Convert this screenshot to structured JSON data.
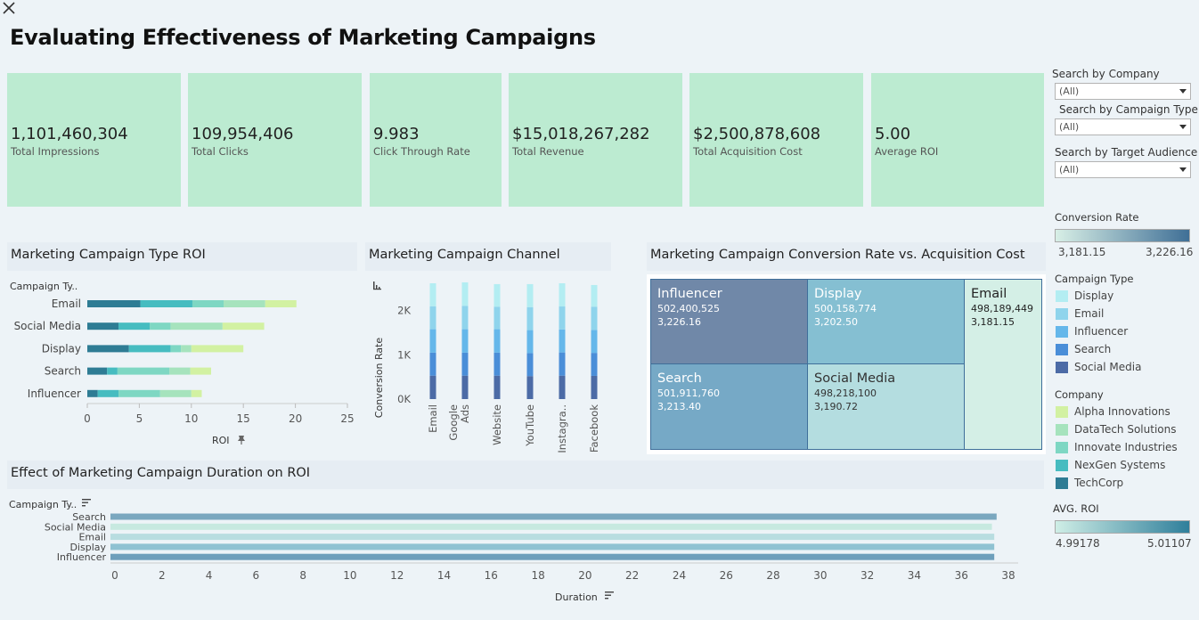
{
  "title": "Evaluating Effectiveness of Marketing Campaigns",
  "kpis": [
    {
      "value": "1,101,460,304",
      "label": "Total Impressions"
    },
    {
      "value": "109,954,406",
      "label": "Total Clicks"
    },
    {
      "value": "9.983",
      "label": "Click Through Rate"
    },
    {
      "value": "$15,018,267,282",
      "label": "Total Revenue"
    },
    {
      "value": "$2,500,878,608",
      "label": "Total Acquisition Cost"
    },
    {
      "value": "5.00",
      "label": "Average ROI"
    }
  ],
  "filters": [
    {
      "label": "Search by Company",
      "value": "(All)"
    },
    {
      "label": "Search by Campaign Type",
      "value": "(All)"
    },
    {
      "label": "Search by Target Audience",
      "value": "(All)"
    }
  ],
  "legends": {
    "conversion_rate": {
      "title": "Conversion Rate",
      "min": "3,181.15",
      "max": "3,226.16",
      "colors": [
        "#d8efe6",
        "#3f6f96"
      ]
    },
    "campaign_type": {
      "title": "Campaign Type",
      "items": [
        {
          "name": "Display",
          "color": "#b3edf2"
        },
        {
          "name": "Email",
          "color": "#8fd4ec"
        },
        {
          "name": "Influencer",
          "color": "#65b7ea"
        },
        {
          "name": "Search",
          "color": "#4a8ed8"
        },
        {
          "name": "Social Media",
          "color": "#4c6ba6"
        }
      ]
    },
    "company": {
      "title": "Company",
      "items": [
        {
          "name": "Alpha Innovations",
          "color": "#d2f1a2"
        },
        {
          "name": "DataTech Solutions",
          "color": "#a6e3bd"
        },
        {
          "name": "Innovate Industries",
          "color": "#7ed7c3"
        },
        {
          "name": "NexGen Systems",
          "color": "#46bcc0"
        },
        {
          "name": "TechCorp",
          "color": "#2e7c94"
        }
      ]
    },
    "avg_roi": {
      "title": "AVG. ROI",
      "min": "4.99178",
      "max": "5.01107",
      "colors": [
        "#cfeee6",
        "#2f7f9b"
      ]
    }
  },
  "panels": {
    "roi": {
      "title": "Marketing Campaign Type ROI",
      "axis_header": "Campaign Ty..",
      "xlabel": "ROI"
    },
    "channel": {
      "title": "Marketing Campaign Channel",
      "ylabel": "Conversion Rate"
    },
    "treemap": {
      "title": "Marketing Campaign Conversion Rate vs. Acquisition Cost"
    },
    "duration": {
      "title": "Effect of Marketing Campaign Duration on ROI",
      "axis_header": "Campaign Ty..",
      "xlabel": "Duration"
    }
  },
  "chart_data": [
    {
      "type": "bar",
      "orientation": "horizontal-stacked",
      "title": "Marketing Campaign Type ROI",
      "categories": [
        "Email",
        "Social Media",
        "Display",
        "Search",
        "Influencer"
      ],
      "series": [
        {
          "name": "TechCorp",
          "color": "#2e7c94",
          "values": [
            5.1,
            3.0,
            4.0,
            1.9,
            1.0
          ]
        },
        {
          "name": "NexGen Systems",
          "color": "#46bcc0",
          "values": [
            5.0,
            3.0,
            4.0,
            1.0,
            2.0
          ]
        },
        {
          "name": "Innovate Industries",
          "color": "#7ed7c3",
          "values": [
            3.0,
            2.0,
            1.0,
            5.0,
            4.0
          ]
        },
        {
          "name": "DataTech Solutions",
          "color": "#a6e3bd",
          "values": [
            4.0,
            5.0,
            1.0,
            2.0,
            3.0
          ]
        },
        {
          "name": "Alpha Innovations",
          "color": "#d2f1a2",
          "values": [
            3.0,
            4.0,
            5.0,
            2.0,
            1.0
          ]
        }
      ],
      "xlabel": "ROI",
      "xlim": [
        0,
        25
      ],
      "xticks": [
        "0",
        "5",
        "10",
        "15",
        "20",
        "25"
      ]
    },
    {
      "type": "bar",
      "orientation": "vertical-stacked",
      "title": "Marketing Campaign Channel",
      "categories": [
        "Email",
        "Google Ads",
        "Website",
        "YouTube",
        "Instagra..",
        "Facebook"
      ],
      "category_lines": [
        [
          "Email"
        ],
        [
          "Google",
          "Ads"
        ],
        [
          "Website"
        ],
        [
          "YouTube"
        ],
        [
          "Instagra.."
        ],
        [
          "Facebook"
        ]
      ],
      "series": [
        {
          "name": "Social Media",
          "color": "#4c6ba6",
          "values": [
            530,
            530,
            530,
            520,
            530,
            525
          ]
        },
        {
          "name": "Search",
          "color": "#4a8ed8",
          "values": [
            520,
            520,
            520,
            520,
            525,
            520
          ]
        },
        {
          "name": "Influencer",
          "color": "#65b7ea",
          "values": [
            530,
            530,
            530,
            520,
            520,
            520
          ]
        },
        {
          "name": "Email",
          "color": "#8fd4ec",
          "values": [
            520,
            530,
            510,
            520,
            520,
            525
          ]
        },
        {
          "name": "Display",
          "color": "#b3edf2",
          "values": [
            520,
            530,
            510,
            520,
            525,
            490
          ]
        }
      ],
      "ylabel": "Conversion Rate",
      "ylim": [
        0,
        2700
      ],
      "yticks": [
        {
          "value": 0,
          "label": "0K"
        },
        {
          "value": 1000,
          "label": "1K"
        },
        {
          "value": 2000,
          "label": "2K"
        }
      ]
    },
    {
      "type": "treemap",
      "title": "Marketing Campaign Conversion Rate vs. Acquisition Cost",
      "items": [
        {
          "name": "Influencer",
          "cost": "502,400,525",
          "rate": "3,226.16",
          "color": "#7088a8",
          "text": "#ffffff"
        },
        {
          "name": "Display",
          "cost": "500,158,774",
          "rate": "3,202.50",
          "color": "#85bfd2",
          "text": "#ffffff"
        },
        {
          "name": "Email",
          "cost": "498,189,449",
          "rate": "3,181.15",
          "color": "#d4efe6",
          "text": "#222222"
        },
        {
          "name": "Search",
          "cost": "501,911,760",
          "rate": "3,213.40",
          "color": "#76a9c6",
          "text": "#ffffff"
        },
        {
          "name": "Social Media",
          "cost": "498,218,100",
          "rate": "3,190.72",
          "color": "#b4dde0",
          "text": "#333333"
        }
      ]
    },
    {
      "type": "bar",
      "orientation": "horizontal",
      "title": "Effect of Marketing Campaign Duration on ROI",
      "categories": [
        "Search",
        "Social Media",
        "Email",
        "Display",
        "Influencer"
      ],
      "values": [
        37.5,
        37.3,
        37.4,
        37.4,
        37.4
      ],
      "colors": [
        "#7aa7bf",
        "#c7e9e0",
        "#b8dde0",
        "#8fc2d2",
        "#6e9fbb"
      ],
      "xlabel": "Duration",
      "xlim": [
        0,
        38
      ],
      "xticks": [
        "0",
        "2",
        "4",
        "6",
        "8",
        "10",
        "12",
        "14",
        "16",
        "18",
        "20",
        "22",
        "24",
        "26",
        "28",
        "30",
        "32",
        "34",
        "36",
        "38"
      ]
    }
  ]
}
